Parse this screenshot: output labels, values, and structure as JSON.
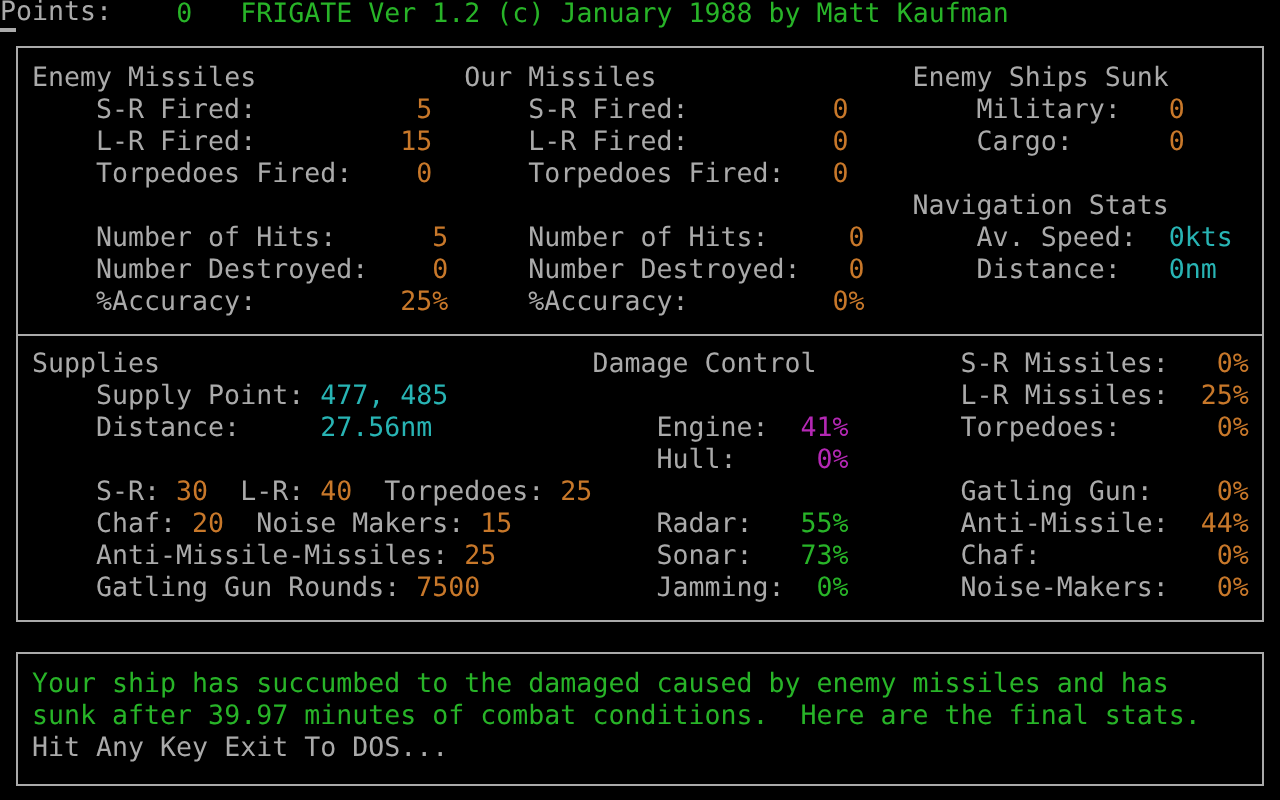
{
  "header": {
    "label": "Points:",
    "value": "0",
    "title": "FRIGATE Ver 1.2 (c) January 1988 by Matt Kaufman"
  },
  "combat_stats": {
    "enemy_missiles": {
      "heading": "Enemy Missiles",
      "groups": [
        [
          {
            "label": "S-R Fired:",
            "value": "5",
            "color": "#c8782a"
          },
          {
            "label": "L-R Fired:",
            "value": "15",
            "color": "#c8782a"
          },
          {
            "label": "Torpedoes Fired:",
            "value": "0",
            "color": "#c8782a"
          }
        ],
        [
          {
            "label": "Number of Hits:",
            "value": "5",
            "color": "#c8782a"
          },
          {
            "label": "Number Destroyed:",
            "value": "0",
            "color": "#c8782a"
          },
          {
            "label": "%Accuracy:",
            "value": "25%",
            "color": "#c8782a"
          }
        ]
      ]
    },
    "our_missiles": {
      "heading": "Our Missiles",
      "groups": [
        [
          {
            "label": "S-R Fired:",
            "value": "0",
            "color": "#c8782a"
          },
          {
            "label": "L-R Fired:",
            "value": "0",
            "color": "#c8782a"
          },
          {
            "label": "Torpedoes Fired:",
            "value": "0",
            "color": "#c8782a"
          }
        ],
        [
          {
            "label": "Number of Hits:",
            "value": "0",
            "color": "#c8782a"
          },
          {
            "label": "Number Destroyed:",
            "value": "0",
            "color": "#c8782a"
          },
          {
            "label": "%Accuracy:",
            "value": "0%",
            "color": "#c8782a"
          }
        ]
      ]
    },
    "enemy_ships_sunk": {
      "heading": "Enemy Ships Sunk",
      "items": [
        {
          "label": "Military:",
          "value": "0",
          "color": "#c8782a"
        },
        {
          "label": "Cargo:",
          "value": "0",
          "color": "#c8782a"
        }
      ]
    },
    "navigation_stats": {
      "heading": "Navigation Stats",
      "items": [
        {
          "label": "Av. Speed:",
          "value": "0kts",
          "color": "#28b4b4"
        },
        {
          "label": "Distance:",
          "value": "0nm",
          "color": "#28b4b4"
        }
      ]
    }
  },
  "status": {
    "supplies": {
      "heading": "Supplies",
      "items": [
        {
          "label": "Supply Point:",
          "value": "477, 485",
          "color": "#28b4b4"
        },
        {
          "label": "Distance:",
          "value": "27.56nm",
          "color": "#28b4b4"
        }
      ],
      "lines": [
        [
          {
            "label": "S-R:",
            "value": "30",
            "color": "#c8782a"
          },
          {
            "label": "L-R:",
            "value": "40",
            "color": "#c8782a"
          },
          {
            "label": "Torpedoes:",
            "value": "25",
            "color": "#c8782a"
          }
        ],
        [
          {
            "label": "Chaf:",
            "value": "20",
            "color": "#c8782a"
          },
          {
            "label": "Noise Makers:",
            "value": "15",
            "color": "#c8782a"
          }
        ],
        [
          {
            "label": "Anti-Missile-Missiles:",
            "value": "25",
            "color": "#c8782a"
          }
        ],
        [
          {
            "label": "Gatling Gun Rounds:",
            "value": "7500",
            "color": "#c8782a"
          }
        ]
      ]
    },
    "damage_control": {
      "heading": "Damage Control",
      "groups": [
        [
          {
            "label": "Engine:",
            "value": "41%",
            "color": "#b428b4"
          },
          {
            "label": "Hull:",
            "value": "0%",
            "color": "#b428b4"
          }
        ],
        [
          {
            "label": "Radar:",
            "value": "55%",
            "color": "#28b428"
          },
          {
            "label": "Sonar:",
            "value": "73%",
            "color": "#28b428"
          },
          {
            "label": "Jamming:",
            "value": "0%",
            "color": "#28b428"
          }
        ]
      ]
    },
    "weapon_damage": {
      "groups": [
        [
          {
            "label": "S-R Missiles:",
            "value": "0%",
            "color": "#c8782a"
          },
          {
            "label": "L-R Missiles:",
            "value": "25%",
            "color": "#c8782a"
          },
          {
            "label": "Torpedoes:",
            "value": "0%",
            "color": "#c8782a"
          }
        ],
        [
          {
            "label": "Gatling Gun:",
            "value": "0%",
            "color": "#c8782a"
          },
          {
            "label": "Anti-Missile:",
            "value": "44%",
            "color": "#c8782a"
          },
          {
            "label": "Chaf:",
            "value": "0%",
            "color": "#c8782a"
          },
          {
            "label": "Noise-Makers:",
            "value": "0%",
            "color": "#c8782a"
          }
        ]
      ]
    }
  },
  "message": {
    "text": "Your ship has succumbed to the damaged caused by enemy missiles and has sunk after 39.97 minutes of combat conditions.  Here are the final stats.",
    "prompt": "Hit Any Key Exit To DOS..."
  }
}
